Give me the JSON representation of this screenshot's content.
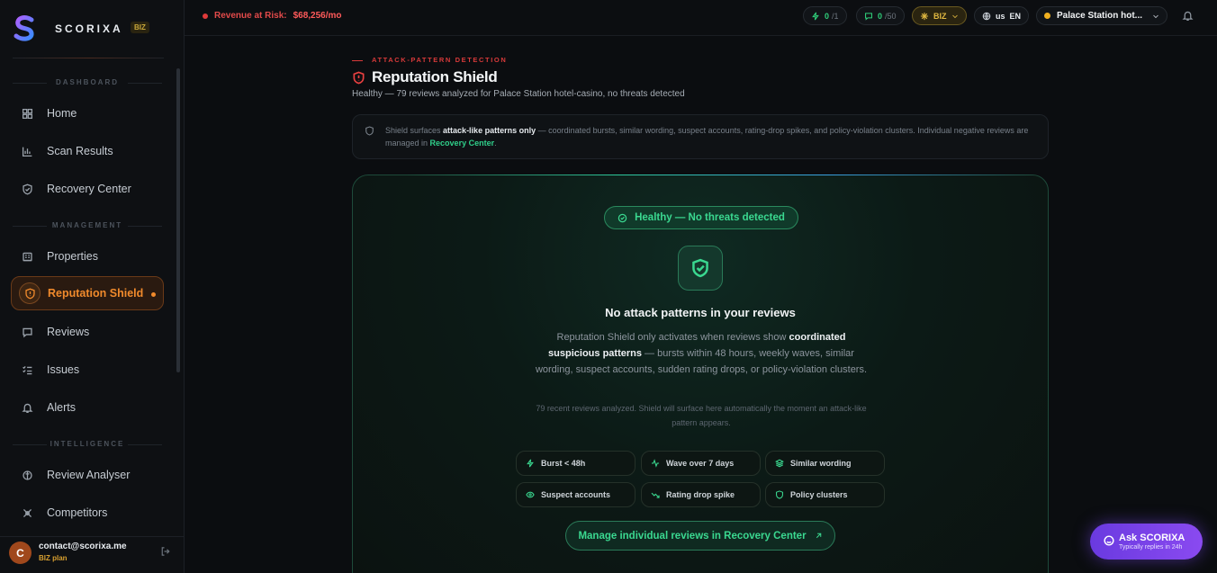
{
  "brand": {
    "name": "SCORIXA",
    "badge": "BIZ"
  },
  "sidebar": {
    "sections": [
      "DASHBOARD",
      "MANAGEMENT",
      "INTELLIGENCE"
    ],
    "items": [
      {
        "label": "Home",
        "icon": "grid-icon"
      },
      {
        "label": "Scan Results",
        "icon": "bar-chart-icon"
      },
      {
        "label": "Recovery Center",
        "icon": "shield-check-icon"
      },
      {
        "label": "Properties",
        "icon": "building-icon"
      },
      {
        "label": "Reputation Shield",
        "icon": "shield-alert-icon",
        "active": true
      },
      {
        "label": "Reviews",
        "icon": "message-icon"
      },
      {
        "label": "Issues",
        "icon": "list-check-icon"
      },
      {
        "label": "Alerts",
        "icon": "bell-icon"
      },
      {
        "label": "Review Analyser",
        "icon": "analyser-icon"
      },
      {
        "label": "Competitors",
        "icon": "crosshair-icon"
      }
    ]
  },
  "user": {
    "initial": "C",
    "email": "contact@scorixa.me",
    "plan": "BIZ plan"
  },
  "topbar": {
    "risk_label": "Revenue at Risk:",
    "risk_value": "$68,256/mo",
    "scans_used": "0",
    "scans_total": "/1",
    "replies_used": "0",
    "replies_total": "/50",
    "plan": "BIZ",
    "region": "us",
    "language": "EN",
    "property": "Palace Station hot..."
  },
  "page": {
    "eyebrow": "ATTACK-PATTERN DETECTION",
    "title": "Reputation Shield",
    "subtitle": "Healthy — 79 reviews analyzed for Palace Station hotel-casino, no threats detected"
  },
  "notice": {
    "pre": "Shield surfaces ",
    "bold": "attack-like patterns only",
    "mid": " — coordinated bursts, similar wording, suspect accounts, rating-drop spikes, and policy-violation clusters. Individual negative reviews are managed in ",
    "link": "Recovery Center",
    "post": "."
  },
  "card": {
    "status": "Healthy — No threats detected",
    "heading": "No attack patterns in your reviews",
    "p_pre": "Reputation Shield only activates when reviews show ",
    "p_bold": "coordinated suspicious patterns",
    "p_post": " — bursts within 48 hours, weekly waves, similar wording, suspect accounts, sudden rating drops, or policy-violation clusters.",
    "small": "79 recent reviews analyzed. Shield will surface here automatically the moment an attack-like pattern appears.",
    "chips": [
      "Burst < 48h",
      "Wave over 7 days",
      "Similar wording",
      "Suspect accounts",
      "Rating drop spike",
      "Policy clusters"
    ],
    "cta": "Manage individual reviews in Recovery Center"
  },
  "assistant": {
    "title": "Ask SCORIXA",
    "subtitle": "Typically replies in 24h"
  },
  "colors": {
    "accent_orange": "#f08a2c",
    "accent_green": "#3ad890",
    "danger": "#e24a4a",
    "assistant": "#7a42e8"
  }
}
